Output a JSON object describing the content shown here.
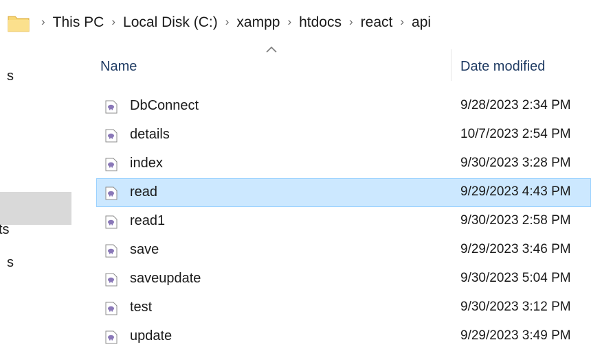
{
  "breadcrumb": {
    "items": [
      "This PC",
      "Local Disk (C:)",
      "xampp",
      "htdocs",
      "react",
      "api"
    ]
  },
  "nav": {
    "items": [
      "s",
      "ts",
      "s"
    ]
  },
  "columns": {
    "name": "Name",
    "date_modified": "Date modified",
    "sorted_by": "name"
  },
  "files": [
    {
      "name": "DbConnect",
      "date": "9/28/2023 2:34 PM",
      "selected": false
    },
    {
      "name": "details",
      "date": "10/7/2023 2:54 PM",
      "selected": false
    },
    {
      "name": "index",
      "date": "9/30/2023 3:28 PM",
      "selected": false
    },
    {
      "name": "read",
      "date": "9/29/2023 4:43 PM",
      "selected": true
    },
    {
      "name": "read1",
      "date": "9/30/2023 2:58 PM",
      "selected": false
    },
    {
      "name": "save",
      "date": "9/29/2023 3:46 PM",
      "selected": false
    },
    {
      "name": "saveupdate",
      "date": "9/30/2023 5:04 PM",
      "selected": false
    },
    {
      "name": "test",
      "date": "9/30/2023 3:12 PM",
      "selected": false
    },
    {
      "name": "update",
      "date": "9/29/2023 3:49 PM",
      "selected": false
    }
  ],
  "colors": {
    "selected_row": "#cce8ff",
    "selected_border": "#99d1ff",
    "header_text": "#1f3b63",
    "folder": "#f8d775"
  },
  "icons": {
    "folder": "folder-icon",
    "file": "php-file-icon",
    "separator": "chevron-right-icon"
  }
}
